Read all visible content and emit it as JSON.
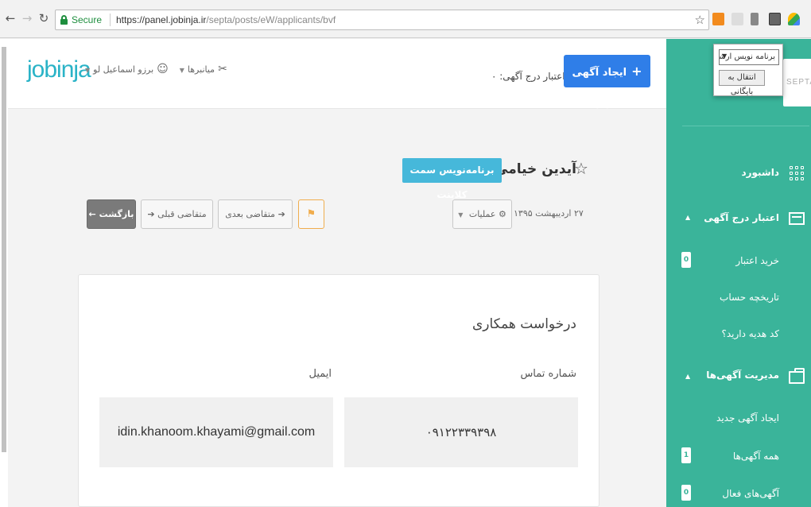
{
  "browser": {
    "secure_label": "Secure",
    "url_host": "https://panel.jobinja.ir",
    "url_path": "/septa/posts/eW/applicants/bvf",
    "extension_popup": {
      "select_value": "برنامه نویس ارشد",
      "button_label": "انتقال به بایگانی"
    }
  },
  "header": {
    "logo": "jobinja",
    "menu_label": "میانبرها",
    "user_name": "برزو اسماعیل لو",
    "credit_text": "اعتبار درج آگهی: ۰",
    "new_ad_button": "ایجاد آگهی جدید"
  },
  "applicant": {
    "name": "آیدین خیامی",
    "job_badge": "برنامه‌نویس سمت کلاینت",
    "date": "۲۷ اردیبهشت ۱۳۹۵",
    "ops_button": "عملیات",
    "next_button": "متقاضی بعدی",
    "prev_button": "متقاضی قبلی",
    "back_button": "بازگشت"
  },
  "card": {
    "title": "درخواست همکاری",
    "phone_label": "شماره تماس",
    "phone_value": "۰۹۱۲۲۳۳۹۳۹۸",
    "email_label": "ایمیل",
    "email_value": "idin.khanoom.khayami@gmail.com"
  },
  "sidebar": {
    "logo": "SEPTA",
    "items": [
      {
        "label": "داشبورد"
      },
      {
        "label": "اعتبار درج آگهی"
      },
      {
        "label": "خرید اعتبار",
        "badge": "0"
      },
      {
        "label": "تاریخچه حساب"
      },
      {
        "label": "کد هدیه دارید؟"
      },
      {
        "label": "مدیریت آگهی‌ها"
      },
      {
        "label": "ایجاد آگهی جدید"
      },
      {
        "label": "همه آگهی‌ها",
        "badge": "1"
      },
      {
        "label": "آگهی‌های فعال",
        "badge": "0"
      }
    ]
  },
  "colors": {
    "sidebar": "#3ab49a",
    "primary_button": "#2f7ee8",
    "badge": "#46b8da",
    "logo": "#2ab3c7"
  }
}
